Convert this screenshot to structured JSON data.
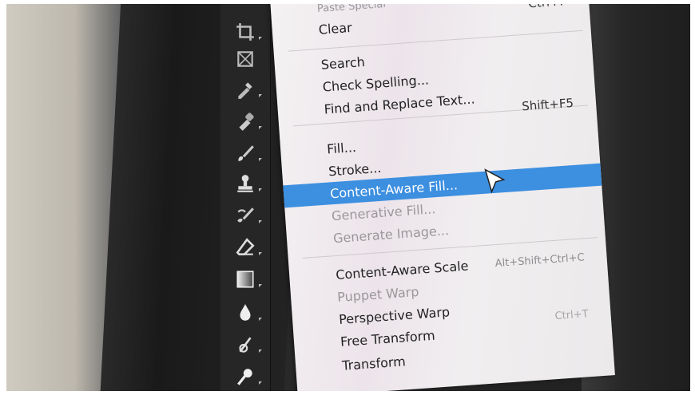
{
  "menu": {
    "items": [
      {
        "label": "Paste Special",
        "shortcut": "",
        "state": "partial"
      },
      {
        "label": "Clear",
        "shortcut": "",
        "state": "normal"
      },
      {
        "label": "",
        "shortcut": "Ctrl+F",
        "state": "normal"
      },
      {
        "label": "Search",
        "shortcut": "",
        "state": "normal"
      },
      {
        "label": "Check Spelling...",
        "shortcut": "",
        "state": "normal"
      },
      {
        "label": "Find and Replace Text...",
        "shortcut": "",
        "state": "normal"
      },
      {
        "label": "",
        "shortcut": "Shift+F5",
        "state": "normal"
      },
      {
        "label": "Fill...",
        "shortcut": "",
        "state": "normal"
      },
      {
        "label": "Stroke...",
        "shortcut": "",
        "state": "normal"
      },
      {
        "label": "Content-Aware Fill...",
        "shortcut": "",
        "state": "highlighted"
      },
      {
        "label": "Generative Fill...",
        "shortcut": "",
        "state": "disabled"
      },
      {
        "label": "Generate Image...",
        "shortcut": "",
        "state": "disabled"
      },
      {
        "label": "Content-Aware Scale",
        "shortcut": "Alt+Shift+Ctrl+C",
        "state": "normal"
      },
      {
        "label": "Puppet Warp",
        "shortcut": "",
        "state": "disabled"
      },
      {
        "label": "Perspective Warp",
        "shortcut": "",
        "state": "normal"
      },
      {
        "label": "Free Transform",
        "shortcut": "Ctrl+T",
        "state": "normal"
      },
      {
        "label": "Transform",
        "shortcut": "",
        "state": "normal"
      }
    ]
  },
  "toolbar": {
    "tools": [
      {
        "icon": "crop-icon"
      },
      {
        "icon": "frame-icon"
      },
      {
        "icon": "eyedropper-icon"
      },
      {
        "icon": "healing-brush-icon"
      },
      {
        "icon": "brush-icon"
      },
      {
        "icon": "clone-stamp-icon"
      },
      {
        "icon": "history-brush-icon"
      },
      {
        "icon": "eraser-icon"
      },
      {
        "icon": "gradient-icon"
      },
      {
        "icon": "blur-icon"
      },
      {
        "icon": "pen-icon"
      },
      {
        "icon": "dodge-icon"
      }
    ]
  },
  "colors": {
    "highlight": "#3d8fe0",
    "menu_bg": "#f2eef0",
    "toolbar_bg": "#262626"
  }
}
